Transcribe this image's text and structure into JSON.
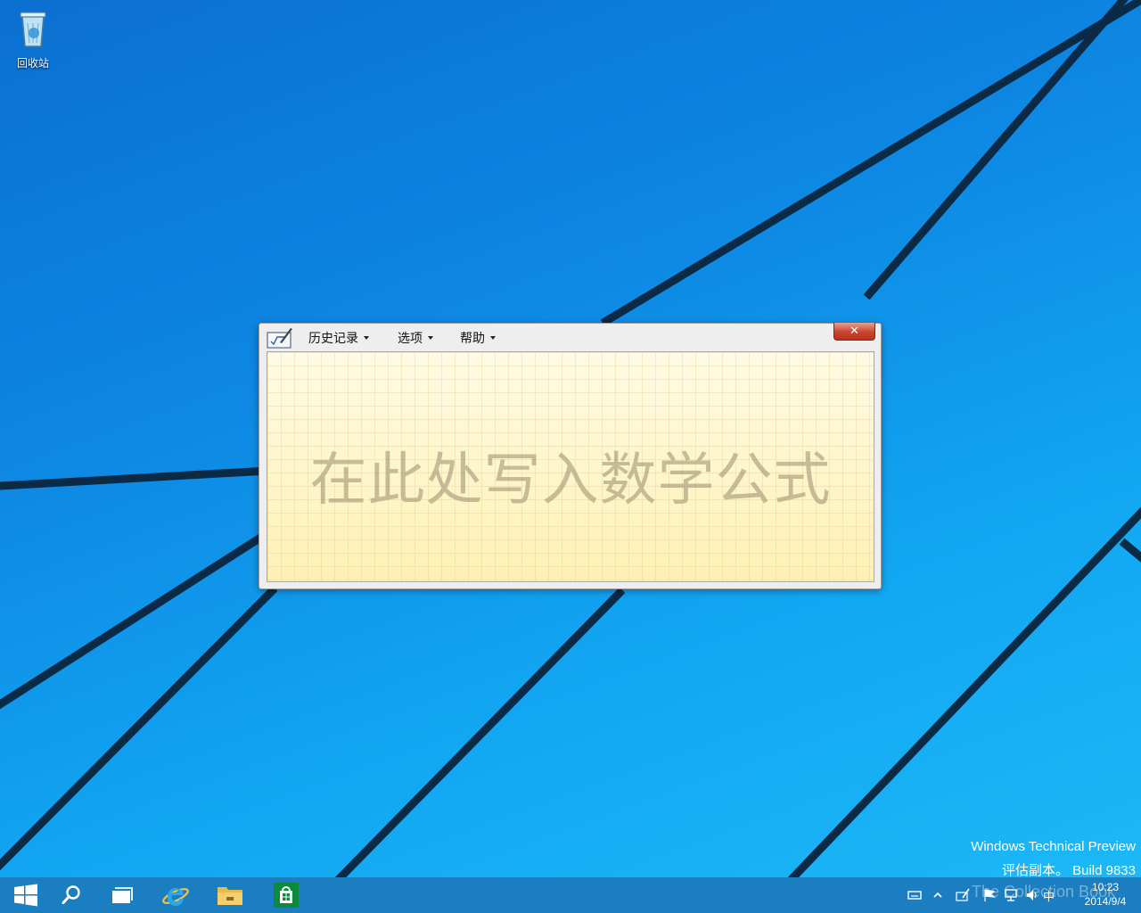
{
  "desktop": {
    "recycle_bin_label": "回收站",
    "watermark_line1": "Windows Technical Preview",
    "watermark_line2": "评估副本。 Build 9833"
  },
  "window": {
    "menu": [
      {
        "label": "历史记录"
      },
      {
        "label": "选项"
      },
      {
        "label": "帮助"
      }
    ],
    "close_glyph": "✕",
    "writing_prompt": "在此处写入数学公式"
  },
  "taskbar": {
    "apps": [
      "start-icon",
      "search-icon",
      "task-view-icon",
      "internet-explorer-icon",
      "file-explorer-icon",
      "store-icon"
    ],
    "ime_indicator": "中",
    "clock_time": "10:23",
    "clock_date": "2014/9/4",
    "overlay_watermark": "The Collection Book"
  },
  "colors": {
    "desktop_blue": "#0d86e2",
    "taskbar": "#1a7ec0",
    "close_red": "#c9452f",
    "writing_area": "#fdf6cc"
  }
}
